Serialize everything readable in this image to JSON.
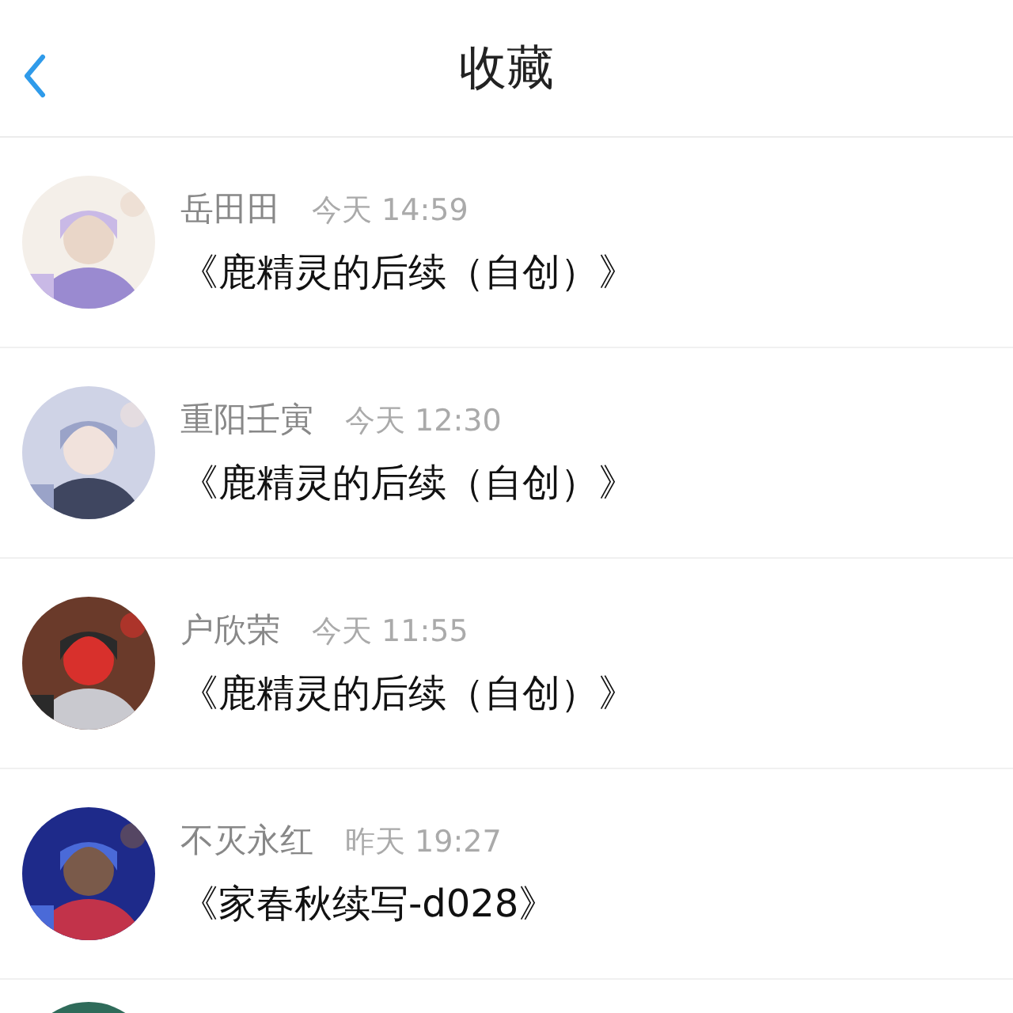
{
  "header": {
    "title": "收藏"
  },
  "items": [
    {
      "kind": "entry",
      "author": "岳田田",
      "time": "今天 14:59",
      "title": "《鹿精灵的后续（自创）》"
    },
    {
      "kind": "entry",
      "author": "重阳壬寅",
      "time": "今天 12:30",
      "title": "《鹿精灵的后续（自创）》"
    },
    {
      "kind": "entry",
      "author": "户欣荣",
      "time": "今天 11:55",
      "title": "《鹿精灵的后续（自创）》"
    },
    {
      "kind": "entry",
      "author": "不灭永红",
      "time": "昨天 19:27",
      "title": "《家春秋续写-d028》"
    },
    {
      "kind": "picture"
    }
  ]
}
